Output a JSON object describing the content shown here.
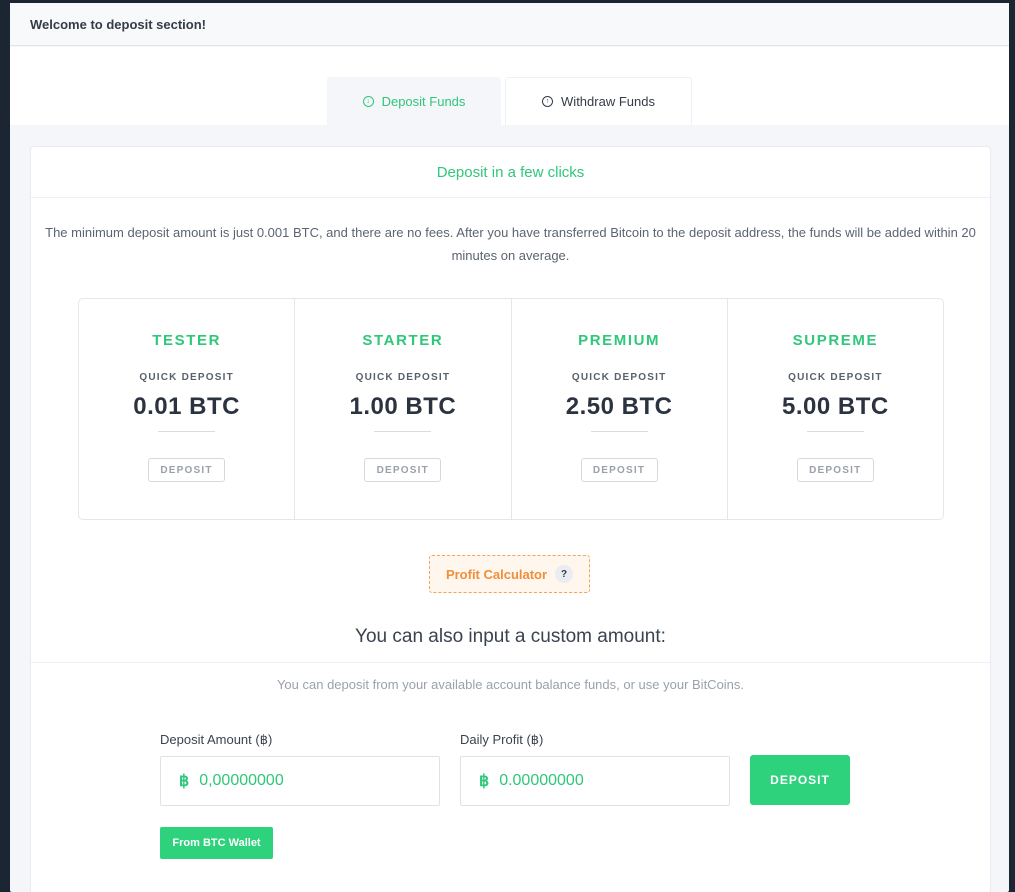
{
  "header": {
    "title": "Welcome to deposit section!"
  },
  "tabs": [
    {
      "label": "Deposit Funds",
      "icon": "arrow-down-circle-icon",
      "active": true
    },
    {
      "label": "Withdraw Funds",
      "icon": "arrow-up-circle-icon",
      "active": false
    }
  ],
  "card": {
    "heading": "Deposit in a few clicks",
    "intro": "The minimum deposit amount is just 0.001 BTC, and there are no fees. After you have transferred Bitcoin to the deposit address, the funds will be added within 20 minutes on average."
  },
  "plans": [
    {
      "name": "TESTER",
      "subtitle": "QUICK DEPOSIT",
      "amount": "0.01 BTC",
      "button": "DEPOSIT"
    },
    {
      "name": "STARTER",
      "subtitle": "QUICK DEPOSIT",
      "amount": "1.00 BTC",
      "button": "DEPOSIT"
    },
    {
      "name": "PREMIUM",
      "subtitle": "QUICK DEPOSIT",
      "amount": "2.50 BTC",
      "button": "DEPOSIT"
    },
    {
      "name": "SUPREME",
      "subtitle": "QUICK DEPOSIT",
      "amount": "5.00 BTC",
      "button": "DEPOSIT"
    }
  ],
  "calculator": {
    "label": "Profit Calculator",
    "help": "?"
  },
  "custom": {
    "title": "You can also input a custom amount:",
    "subtitle": "You can deposit from your available account balance funds, or use your BitCoins.",
    "deposit_amount": {
      "label": "Deposit Amount (฿)",
      "symbol": "฿",
      "placeholder": "0,00000000"
    },
    "daily_profit": {
      "label": "Daily Profit (฿)",
      "symbol": "฿",
      "value": "0.00000000"
    },
    "deposit_button": "DEPOSIT",
    "wallet_button": "From BTC Wallet"
  },
  "colors": {
    "accent": "#2fc77a",
    "button": "#2ed27d",
    "orange": "#ef8e3b"
  }
}
